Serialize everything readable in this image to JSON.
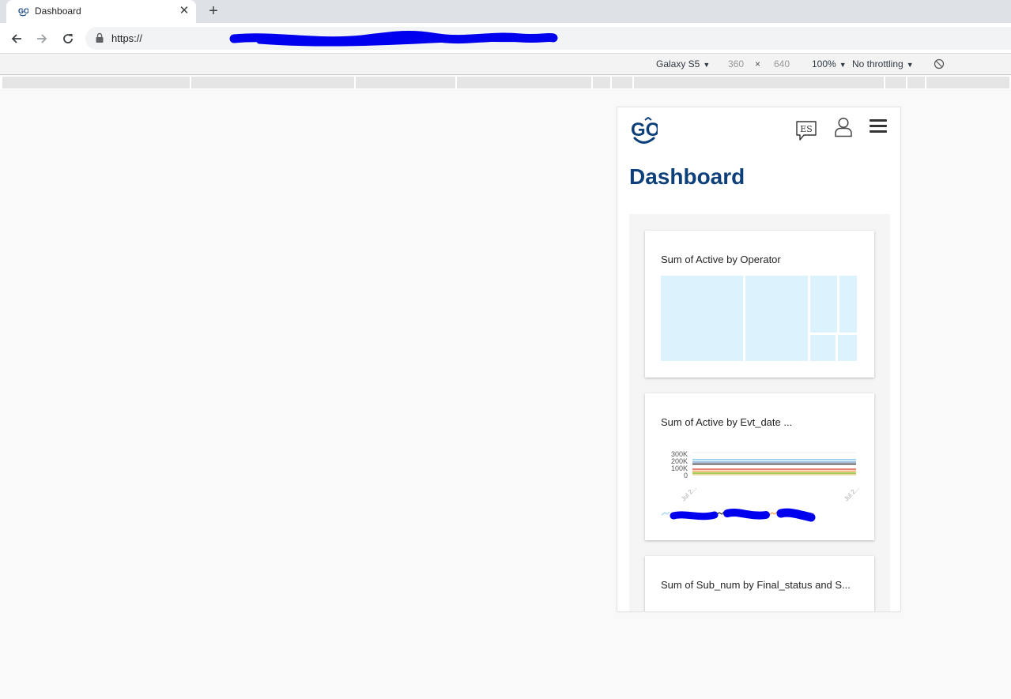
{
  "browser": {
    "tab_title": "Dashboard",
    "url_prefix": "https://"
  },
  "devtools": {
    "device": "Galaxy S5",
    "width": "360",
    "times": "×",
    "height": "640",
    "zoom": "100%",
    "throttling": "No throttling"
  },
  "app": {
    "page_title": "Dashboard",
    "lang_icon_label": "ES",
    "brand_color": "#0d3f7a",
    "cards": [
      {
        "title": "Sum of Active by Operator"
      },
      {
        "title": "Sum of Active by Evt_date ..."
      },
      {
        "title": "Sum of Sub_num by Final_status and S..."
      }
    ]
  },
  "chart_data": [
    {
      "type": "treemap",
      "title": "Sum of Active by Operator",
      "values": [],
      "fill_color": "#dcf2fc"
    },
    {
      "type": "line",
      "title": "Sum of Active by Evt_date ...",
      "yticks": [
        "300K",
        "200K",
        "100K",
        "0"
      ],
      "ylim": [
        0,
        300000
      ],
      "xticks": [
        "Jul 2...",
        "Jul 2..."
      ],
      "series_colors": [
        "#9ed4ef",
        "#7aa8d8",
        "#2b2b2b",
        "#e35a4f",
        "#f0a04b",
        "#a9c957"
      ],
      "legend_placement": "bottom"
    }
  ]
}
